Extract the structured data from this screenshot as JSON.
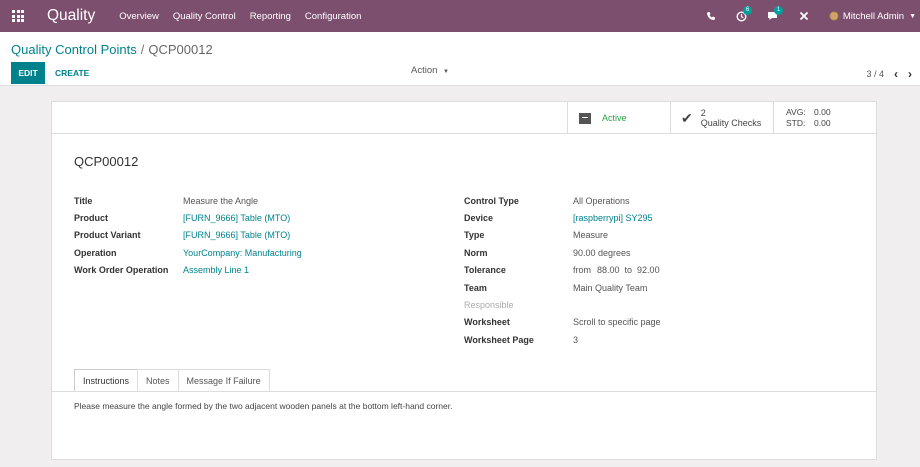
{
  "navbar": {
    "brand": "Quality",
    "menu": [
      "Overview",
      "Quality Control",
      "Reporting",
      "Configuration"
    ],
    "activity_badge": "6",
    "messages_badge": "1",
    "user_name": "Mitchell Admin"
  },
  "breadcrumb": {
    "parent": "Quality Control Points",
    "separator": "/",
    "current": "QCP00012"
  },
  "buttons": {
    "edit": "EDIT",
    "create": "CREATE",
    "action": "Action"
  },
  "pager": {
    "value": "3 / 4"
  },
  "smart_buttons": {
    "active": "Active",
    "checks_count": "2",
    "checks_label": "Quality Checks",
    "avg_label": "AVG:",
    "avg_value": "0.00",
    "std_label": "STD:",
    "std_value": "0.00"
  },
  "record": {
    "name": "QCP00012"
  },
  "left_fields": [
    {
      "label": "Title",
      "value": "Measure the Angle"
    },
    {
      "label": "Product",
      "value": "[FURN_9666] Table (MTO)"
    },
    {
      "label": "Product Variant",
      "value": "[FURN_9666] Table (MTO)"
    },
    {
      "label": "Operation",
      "value": "YourCompany: Manufacturing"
    },
    {
      "label": "Work Order Operation",
      "value": "Assembly Line 1"
    }
  ],
  "right_fields": [
    {
      "label": "Control Type",
      "value": "All Operations"
    },
    {
      "label": "Device",
      "value": "[raspberrypi] SY295"
    },
    {
      "label": "Type",
      "value": "Measure"
    },
    {
      "label": "Norm",
      "value": "90.00 degrees"
    },
    {
      "label": "Tolerance",
      "from_label": "from",
      "from": "88.00",
      "to_label": "to",
      "to": "92.00"
    },
    {
      "label": "Team",
      "value": "Main Quality Team"
    },
    {
      "label": "Responsible",
      "value": ""
    },
    {
      "label": "Worksheet",
      "value": "Scroll to specific page"
    },
    {
      "label": "Worksheet Page",
      "value": "3"
    }
  ],
  "tabs": [
    "Instructions",
    "Notes",
    "Message If Failure"
  ],
  "instructions_text": "Please measure the angle formed by the two adjacent wooden panels at the bottom left-hand corner.",
  "colors": {
    "navbar": "#7c4f6f",
    "primary": "#00828c",
    "active_green": "#28a745"
  }
}
